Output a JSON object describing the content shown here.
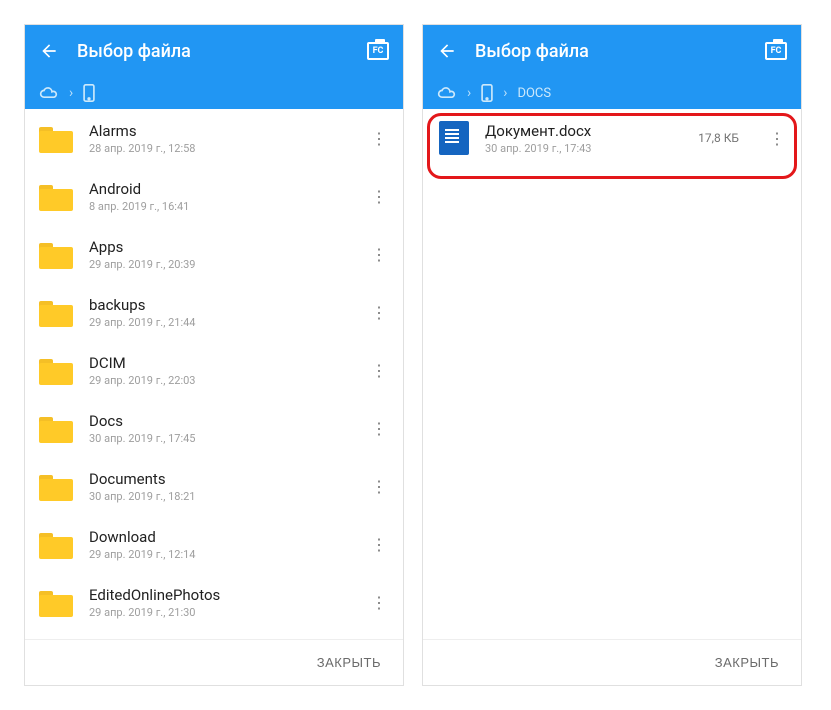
{
  "left": {
    "title": "Выбор файла",
    "breadcrumb": [],
    "items": [
      {
        "name": "Alarms",
        "meta": "28 апр. 2019 г., 12:58"
      },
      {
        "name": "Android",
        "meta": "8 апр. 2019 г., 16:41"
      },
      {
        "name": "Apps",
        "meta": "29 апр. 2019 г., 20:39"
      },
      {
        "name": "backups",
        "meta": "29 апр. 2019 г., 21:44"
      },
      {
        "name": "DCIM",
        "meta": "29 апр. 2019 г., 22:03"
      },
      {
        "name": "Docs",
        "meta": "30 апр. 2019 г., 17:45"
      },
      {
        "name": "Documents",
        "meta": "30 апр. 2019 г., 18:21"
      },
      {
        "name": "Download",
        "meta": "29 апр. 2019 г., 12:14"
      },
      {
        "name": "EditedOnlinePhotos",
        "meta": "29 апр. 2019 г., 21:30"
      }
    ],
    "close": "ЗАКРЫТЬ"
  },
  "right": {
    "title": "Выбор файла",
    "breadcrumb_label": "DOCS",
    "items": [
      {
        "name": "Документ.docx",
        "meta": "30 апр. 2019 г., 17:43",
        "size": "17,8 КБ"
      }
    ],
    "close": "ЗАКРЫТЬ"
  }
}
